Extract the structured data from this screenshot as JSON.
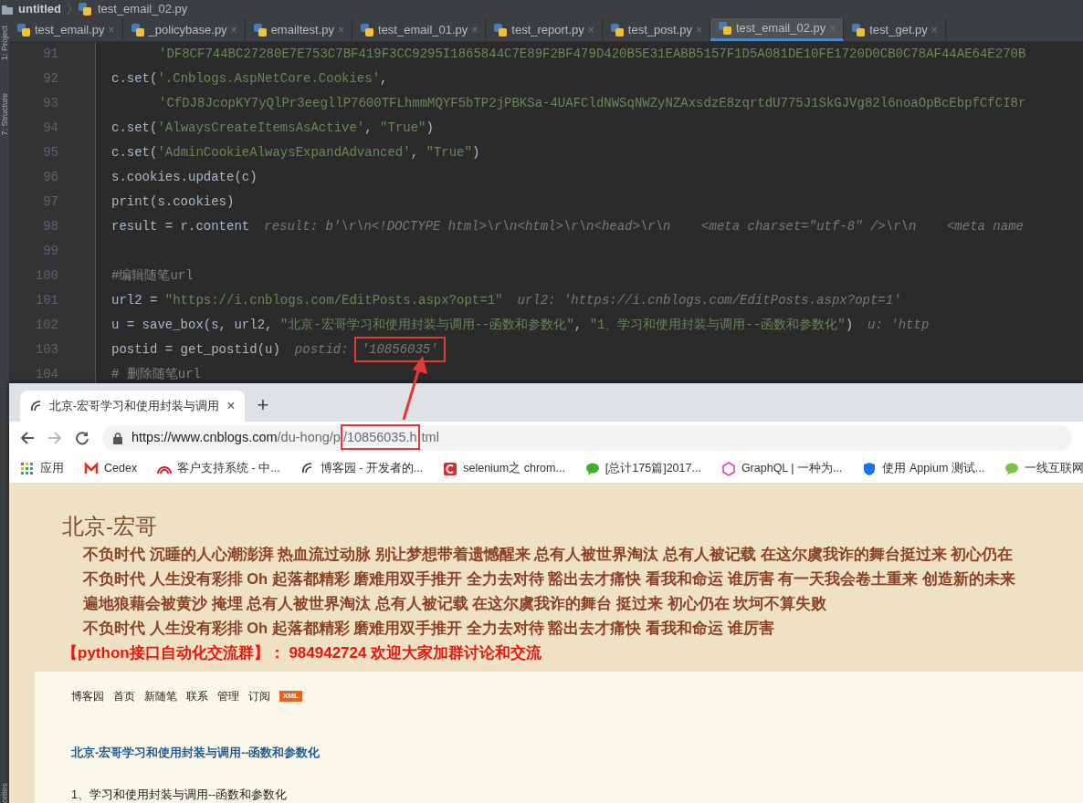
{
  "ide": {
    "breadcrumbs": [
      "untitled",
      "test_email_02.py"
    ],
    "side_tools": [
      "1: Project",
      "7: Structure"
    ],
    "bottom_tool": "orites",
    "tabs": [
      {
        "label": "test_email.py",
        "selected": false
      },
      {
        "label": "_policybase.py",
        "selected": false
      },
      {
        "label": "emailtest.py",
        "selected": false
      },
      {
        "label": "test_email_01.py",
        "selected": false
      },
      {
        "label": "test_report.py",
        "selected": false
      },
      {
        "label": "test_post.py",
        "selected": false
      },
      {
        "label": "test_email_02.py",
        "selected": true
      },
      {
        "label": "test_get.py",
        "selected": false
      }
    ],
    "close_mark": "×",
    "code_lines": [
      {
        "number": "91",
        "continuation": true,
        "segments": [
          {
            "kind": "string",
            "text": "'DF8CF744BC27280E7E753C7BF419F3CC9295I1865844C7E89F2BF479D420B5E31EABB5157F1D5A081DE10FE1720D0CB0C78AF44AE64E270B"
          }
        ]
      },
      {
        "number": "92",
        "continuation": false,
        "segments": [
          {
            "kind": "code",
            "text": "c.set("
          },
          {
            "kind": "string",
            "text": "'.Cnblogs.AspNetCore.Cookies'"
          },
          {
            "kind": "code",
            "text": ","
          }
        ]
      },
      {
        "number": "93",
        "continuation": true,
        "segments": [
          {
            "kind": "string",
            "text": "'CfDJ8JcopKY7yQlPr3eegllP7600TFLhmmMQYF5bTP2jPBKSa-4UAFCldNWSqNWZyNZAxsdzE8zqrtdU775J1SkGJVg82l6noaOpBcEbpfCfCI8r"
          }
        ]
      },
      {
        "number": "94",
        "continuation": false,
        "segments": [
          {
            "kind": "code",
            "text": "c.set("
          },
          {
            "kind": "string",
            "text": "'AlwaysCreateItemsAsActive'"
          },
          {
            "kind": "code",
            "text": ", "
          },
          {
            "kind": "string",
            "text": "\"True\""
          },
          {
            "kind": "code",
            "text": ")"
          }
        ]
      },
      {
        "number": "95",
        "continuation": false,
        "segments": [
          {
            "kind": "code",
            "text": "c.set("
          },
          {
            "kind": "string",
            "text": "'AdminCookieAlwaysExpandAdvanced'"
          },
          {
            "kind": "code",
            "text": ", "
          },
          {
            "kind": "string",
            "text": "\"True\""
          },
          {
            "kind": "code",
            "text": ")"
          }
        ]
      },
      {
        "number": "96",
        "continuation": false,
        "segments": [
          {
            "kind": "code",
            "text": "s.cookies.update(c)"
          }
        ]
      },
      {
        "number": "97",
        "continuation": false,
        "segments": [
          {
            "kind": "code",
            "text": "print(s.cookies)"
          }
        ]
      },
      {
        "number": "98",
        "continuation": false,
        "segments": [
          {
            "kind": "code",
            "text": "result = r.content"
          },
          {
            "kind": "hint",
            "text": "result: b'\\r\\n<!DOCTYPE html>\\r\\n<html>\\r\\n<head>\\r\\n    <meta charset=\"utf-8\" />\\r\\n    <meta name"
          }
        ]
      },
      {
        "number": "99"
      },
      {
        "number": "100",
        "continuation": false,
        "segments": [
          {
            "kind": "comment",
            "text": "#编辑随笔url"
          }
        ]
      },
      {
        "number": "101",
        "continuation": false,
        "segments": [
          {
            "kind": "code",
            "text": "url2 = "
          },
          {
            "kind": "string",
            "text": "\"https://i.cnblogs.com/EditPosts.aspx?opt=1\""
          },
          {
            "kind": "hint",
            "text": "url2: 'https://i.cnblogs.com/EditPosts.aspx?opt=1'"
          }
        ]
      },
      {
        "number": "102",
        "continuation": false,
        "segments": [
          {
            "kind": "code",
            "text": "u = save_box(s, url2, "
          },
          {
            "kind": "string",
            "text": "\"北京-宏哥学习和使用封装与调用--函数和参数化\""
          },
          {
            "kind": "code",
            "text": ", "
          },
          {
            "kind": "string",
            "text": "\"1、学习和使用封装与调用--函数和参数化\""
          },
          {
            "kind": "code",
            "text": ")"
          },
          {
            "kind": "hint",
            "text": "u: 'http"
          }
        ]
      },
      {
        "number": "103",
        "continuation": false,
        "segments": [
          {
            "kind": "code",
            "text": "postid = get_postid(u)"
          },
          {
            "kind": "hint",
            "text": "postid:"
          },
          {
            "kind": "boxed",
            "text": "'10856035'"
          }
        ]
      },
      {
        "number": "104",
        "continuation": false,
        "segments": [
          {
            "kind": "comment",
            "text": "# 删除随笔url"
          }
        ]
      }
    ]
  },
  "browser": {
    "tab_title": "北京-宏哥学习和使用封装与调用",
    "tab_close": "×",
    "new_tab": "+",
    "url_parts": [
      {
        "kind": "host",
        "text": "https://www.cnblogs.com"
      },
      {
        "kind": "path",
        "text": "/du-hong/p"
      },
      {
        "kind": "boxed",
        "text": "/10856035.h"
      },
      {
        "kind": "path",
        "text": "tml"
      }
    ],
    "bookmarks": [
      "应用",
      "Cedex",
      "客户支持系统 - 中...",
      "博客园 - 开发者的...",
      "selenium之 chrom...",
      "[总计175篇]2017...",
      "GraphQL | 一种为...",
      "使用 Appium 测试...",
      "一线互联网"
    ],
    "page": {
      "site_title": "北京-宏哥",
      "lines": [
        "不负时代 沉睡的人心潮澎湃 热血流过动脉 别让梦想带着遗憾醒来 总有人被世界淘汰 总有人被记载 在这尔虞我诈的舞台挺过来 初心仍在",
        "不负时代 人生没有彩排 Oh 起落都精彩 磨难用双手推开 全力去对待 豁出去才痛快 看我和命运 谁厉害 有一天我会卷土重来 创造新的未来",
        "遍地狼藉会被黄沙 掩埋 总有人被世界淘汰 总有人被记载 在这尔虞我诈的舞台 挺过来 初心仍在 坎坷不算失败",
        "不负时代 人生没有彩排 Oh 起落都精彩 磨难用双手推开 全力去对待 豁出去才痛快 看我和命运 谁厉害"
      ],
      "notice": "【python接口自动化交流群】： 984942724 欢迎大家加群讨论和交流",
      "nav": [
        "博客园",
        "首页",
        "新随笔",
        "联系",
        "管理",
        "订阅"
      ],
      "xml_badge": "XML",
      "post_title": "北京-宏哥学习和使用封装与调用--函数和参数化",
      "post_body": "1、学习和使用封装与调用--函数和参数化"
    }
  }
}
